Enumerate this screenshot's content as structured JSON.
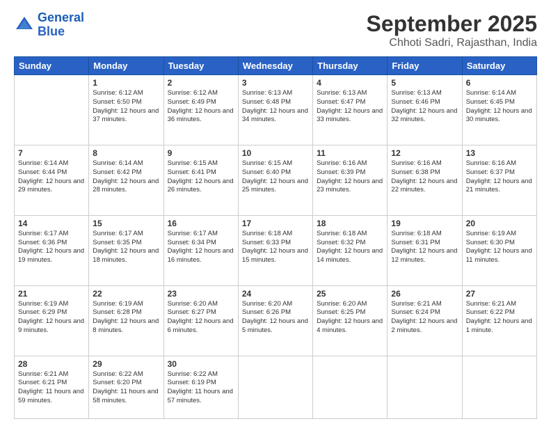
{
  "header": {
    "logo_line1": "General",
    "logo_line2": "Blue",
    "main_title": "September 2025",
    "subtitle": "Chhoti Sadri, Rajasthan, India"
  },
  "calendar": {
    "days_of_week": [
      "Sunday",
      "Monday",
      "Tuesday",
      "Wednesday",
      "Thursday",
      "Friday",
      "Saturday"
    ],
    "weeks": [
      [
        {
          "day": "",
          "info": ""
        },
        {
          "day": "1",
          "info": "Sunrise: 6:12 AM\nSunset: 6:50 PM\nDaylight: 12 hours and 37 minutes."
        },
        {
          "day": "2",
          "info": "Sunrise: 6:12 AM\nSunset: 6:49 PM\nDaylight: 12 hours and 36 minutes."
        },
        {
          "day": "3",
          "info": "Sunrise: 6:13 AM\nSunset: 6:48 PM\nDaylight: 12 hours and 34 minutes."
        },
        {
          "day": "4",
          "info": "Sunrise: 6:13 AM\nSunset: 6:47 PM\nDaylight: 12 hours and 33 minutes."
        },
        {
          "day": "5",
          "info": "Sunrise: 6:13 AM\nSunset: 6:46 PM\nDaylight: 12 hours and 32 minutes."
        },
        {
          "day": "6",
          "info": "Sunrise: 6:14 AM\nSunset: 6:45 PM\nDaylight: 12 hours and 30 minutes."
        }
      ],
      [
        {
          "day": "7",
          "info": "Sunrise: 6:14 AM\nSunset: 6:44 PM\nDaylight: 12 hours and 29 minutes."
        },
        {
          "day": "8",
          "info": "Sunrise: 6:14 AM\nSunset: 6:42 PM\nDaylight: 12 hours and 28 minutes."
        },
        {
          "day": "9",
          "info": "Sunrise: 6:15 AM\nSunset: 6:41 PM\nDaylight: 12 hours and 26 minutes."
        },
        {
          "day": "10",
          "info": "Sunrise: 6:15 AM\nSunset: 6:40 PM\nDaylight: 12 hours and 25 minutes."
        },
        {
          "day": "11",
          "info": "Sunrise: 6:16 AM\nSunset: 6:39 PM\nDaylight: 12 hours and 23 minutes."
        },
        {
          "day": "12",
          "info": "Sunrise: 6:16 AM\nSunset: 6:38 PM\nDaylight: 12 hours and 22 minutes."
        },
        {
          "day": "13",
          "info": "Sunrise: 6:16 AM\nSunset: 6:37 PM\nDaylight: 12 hours and 21 minutes."
        }
      ],
      [
        {
          "day": "14",
          "info": "Sunrise: 6:17 AM\nSunset: 6:36 PM\nDaylight: 12 hours and 19 minutes."
        },
        {
          "day": "15",
          "info": "Sunrise: 6:17 AM\nSunset: 6:35 PM\nDaylight: 12 hours and 18 minutes."
        },
        {
          "day": "16",
          "info": "Sunrise: 6:17 AM\nSunset: 6:34 PM\nDaylight: 12 hours and 16 minutes."
        },
        {
          "day": "17",
          "info": "Sunrise: 6:18 AM\nSunset: 6:33 PM\nDaylight: 12 hours and 15 minutes."
        },
        {
          "day": "18",
          "info": "Sunrise: 6:18 AM\nSunset: 6:32 PM\nDaylight: 12 hours and 14 minutes."
        },
        {
          "day": "19",
          "info": "Sunrise: 6:18 AM\nSunset: 6:31 PM\nDaylight: 12 hours and 12 minutes."
        },
        {
          "day": "20",
          "info": "Sunrise: 6:19 AM\nSunset: 6:30 PM\nDaylight: 12 hours and 11 minutes."
        }
      ],
      [
        {
          "day": "21",
          "info": "Sunrise: 6:19 AM\nSunset: 6:29 PM\nDaylight: 12 hours and 9 minutes."
        },
        {
          "day": "22",
          "info": "Sunrise: 6:19 AM\nSunset: 6:28 PM\nDaylight: 12 hours and 8 minutes."
        },
        {
          "day": "23",
          "info": "Sunrise: 6:20 AM\nSunset: 6:27 PM\nDaylight: 12 hours and 6 minutes."
        },
        {
          "day": "24",
          "info": "Sunrise: 6:20 AM\nSunset: 6:26 PM\nDaylight: 12 hours and 5 minutes."
        },
        {
          "day": "25",
          "info": "Sunrise: 6:20 AM\nSunset: 6:25 PM\nDaylight: 12 hours and 4 minutes."
        },
        {
          "day": "26",
          "info": "Sunrise: 6:21 AM\nSunset: 6:24 PM\nDaylight: 12 hours and 2 minutes."
        },
        {
          "day": "27",
          "info": "Sunrise: 6:21 AM\nSunset: 6:22 PM\nDaylight: 12 hours and 1 minute."
        }
      ],
      [
        {
          "day": "28",
          "info": "Sunrise: 6:21 AM\nSunset: 6:21 PM\nDaylight: 11 hours and 59 minutes."
        },
        {
          "day": "29",
          "info": "Sunrise: 6:22 AM\nSunset: 6:20 PM\nDaylight: 11 hours and 58 minutes."
        },
        {
          "day": "30",
          "info": "Sunrise: 6:22 AM\nSunset: 6:19 PM\nDaylight: 11 hours and 57 minutes."
        },
        {
          "day": "",
          "info": ""
        },
        {
          "day": "",
          "info": ""
        },
        {
          "day": "",
          "info": ""
        },
        {
          "day": "",
          "info": ""
        }
      ]
    ]
  }
}
